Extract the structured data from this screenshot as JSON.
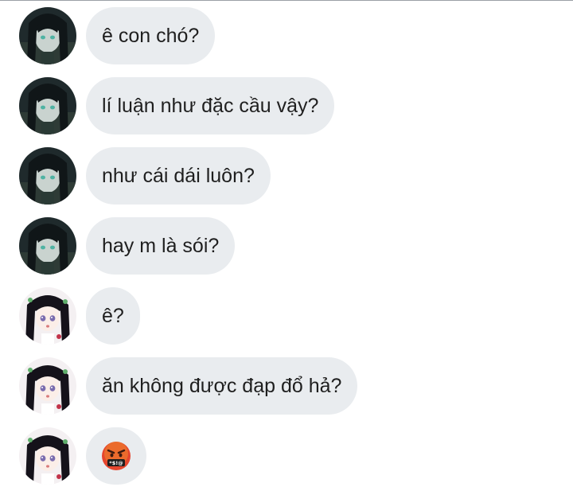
{
  "messages": [
    {
      "sender": "avatar-dark",
      "text": "ê con chó?"
    },
    {
      "sender": "avatar-dark",
      "text": "lí luận như đặc cầu vậy?"
    },
    {
      "sender": "avatar-dark",
      "text": "như cái dái luôn?"
    },
    {
      "sender": "avatar-dark",
      "text": "hay m là sói?"
    },
    {
      "sender": "avatar-girl",
      "text": "ê?"
    },
    {
      "sender": "avatar-girl",
      "text": "ăn không được đạp đổ hả?"
    },
    {
      "sender": "avatar-girl",
      "icon": "angry-cursing-face-emoji"
    }
  ],
  "colors": {
    "bubble": "#e9ecef",
    "text": "#1f1f1f",
    "top_border": "#9aa0a6"
  }
}
